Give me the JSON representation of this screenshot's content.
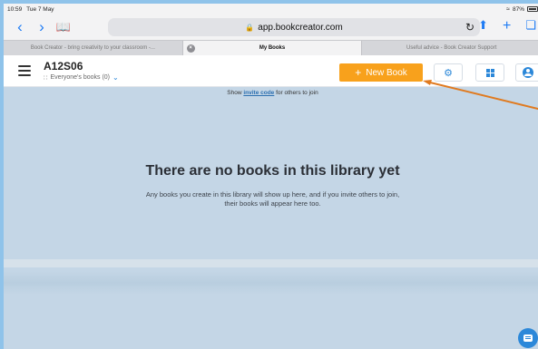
{
  "status": {
    "time": "10:59",
    "date": "Tue 7 May",
    "battery": "87%"
  },
  "browser": {
    "url": "app.bookcreator.com",
    "tabs": [
      {
        "label": "Book Creator - bring creativity to your classroom -..."
      },
      {
        "label": "My Books"
      },
      {
        "label": "Useful advice - Book Creator Support"
      }
    ]
  },
  "header": {
    "library_name": "A12S06",
    "filter_label": "Everyone's books (0)",
    "new_book_label": "New Book"
  },
  "main": {
    "invite_prefix": "Show ",
    "invite_link": "invite code",
    "invite_suffix": " for others to join",
    "empty_title": "There are no books in this library yet",
    "empty_desc": "Any books you create in this library will show up here, and if you invite others to join, their books will appear here too."
  },
  "colors": {
    "accent_orange": "#f8a11c",
    "accent_blue": "#2c88d9",
    "annotation_arrow": "#e07a1f"
  }
}
